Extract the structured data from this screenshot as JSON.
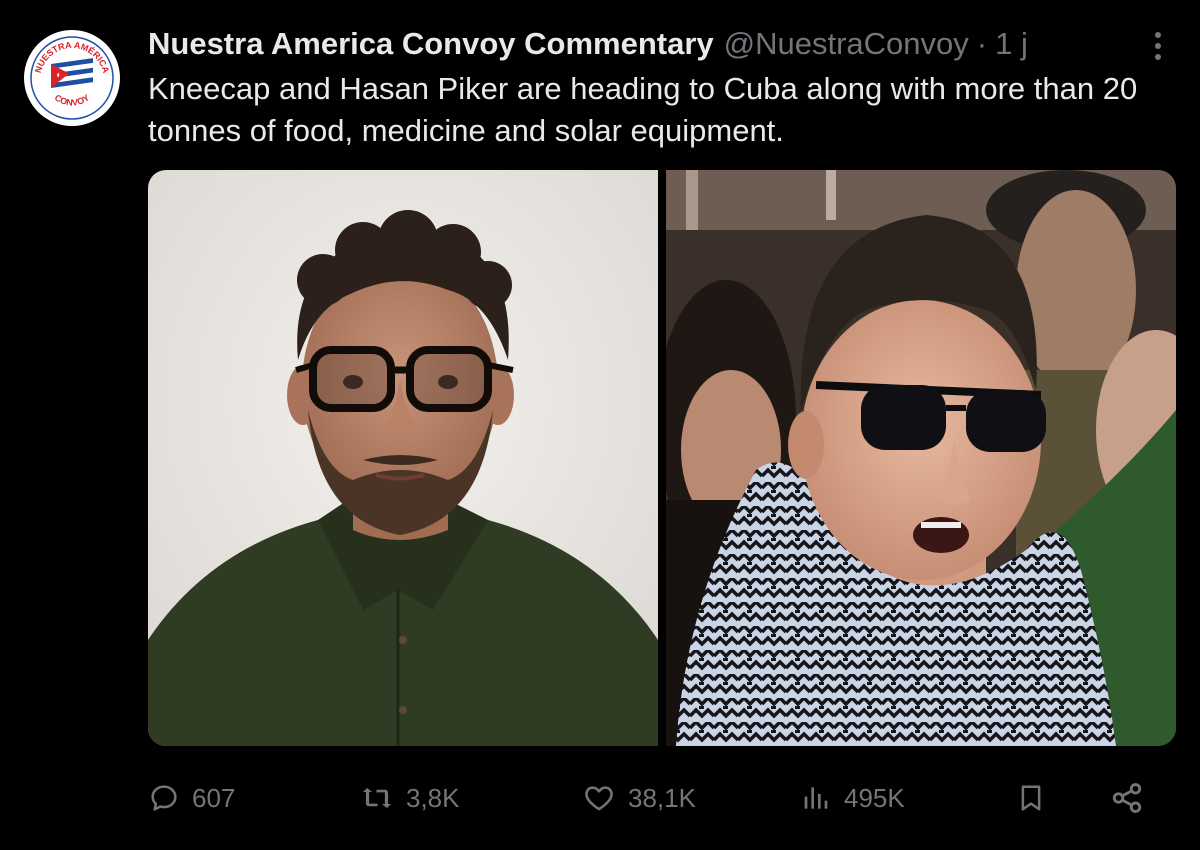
{
  "author": {
    "display_name": "Nuestra America Convoy Commentary",
    "handle": "@NuestraConvoy",
    "separator": "·",
    "time": "1 j",
    "avatar": {
      "text_top": "NUESTRA AMÉRICA",
      "text_bottom": "CONVOY"
    }
  },
  "tweet": {
    "text": "Kneecap and Hasan Piker are heading to Cuba along with more than 20 tonnes of food, medicine and solar equipment."
  },
  "actions": {
    "replies": "607",
    "reposts": "3,8K",
    "likes": "38,1K",
    "views": "495K"
  },
  "colors": {
    "background": "#000000",
    "primary_text": "#e7e9ea",
    "secondary_text": "#71767b",
    "brand_red": "#d9252a",
    "brand_blue": "#1f4fa3"
  },
  "icons": {
    "more": "more-horizontal-icon",
    "reply": "reply-icon",
    "repost": "repost-icon",
    "like": "heart-icon",
    "views": "analytics-icon",
    "bookmark": "bookmark-icon",
    "share": "share-icon"
  }
}
